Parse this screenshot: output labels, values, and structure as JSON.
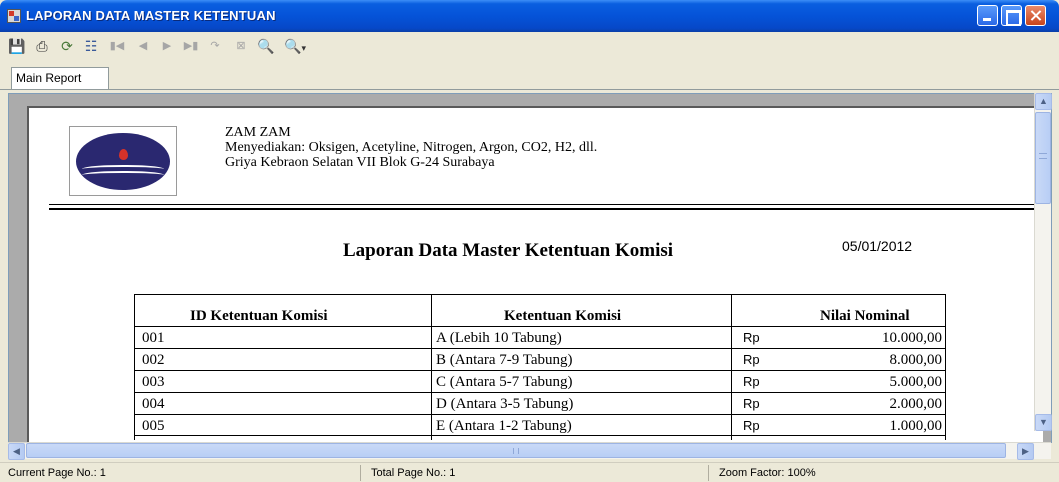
{
  "window": {
    "title": "LAPORAN DATA MASTER KETENTUAN"
  },
  "toolbar": {
    "buttons": [
      {
        "name": "export-icon",
        "glyph": "⎘"
      },
      {
        "name": "print-icon",
        "glyph": "⎙"
      },
      {
        "name": "refresh-icon",
        "glyph": "⟳"
      },
      {
        "name": "group-tree-icon",
        "glyph": "☷"
      },
      {
        "name": "first-page-icon",
        "glyph": "⏮"
      },
      {
        "name": "previous-page-icon",
        "glyph": "◀"
      },
      {
        "name": "next-page-icon",
        "glyph": "▶"
      },
      {
        "name": "last-page-icon",
        "glyph": "⏭"
      },
      {
        "name": "goto-page-icon",
        "glyph": "⤵"
      },
      {
        "name": "close-view-icon",
        "glyph": "⊠"
      },
      {
        "name": "find-icon",
        "glyph": "⚲"
      },
      {
        "name": "zoom-icon",
        "glyph": "⚲"
      }
    ]
  },
  "tabs": {
    "main_report": "Main Report"
  },
  "report": {
    "company_name": "ZAM ZAM",
    "company_desc": "Menyediakan: Oksigen, Acetyline, Nitrogen, Argon, CO2, H2, dll.",
    "company_address": "Griya Kebraon Selatan VII Blok G-24 Surabaya",
    "title": "Laporan Data Master Ketentuan Komisi",
    "date": "05/01/2012",
    "columns": [
      "ID  Ketentuan Komisi",
      "Ketentuan Komisi",
      "Nilai Nominal"
    ],
    "rows": [
      {
        "id": "001",
        "ketentuan": "A (Lebih 10 Tabung)",
        "currency": "Rp",
        "nominal": "10.000,00"
      },
      {
        "id": "002",
        "ketentuan": "B (Antara 7-9 Tabung)",
        "currency": "Rp",
        "nominal": "8.000,00"
      },
      {
        "id": "003",
        "ketentuan": "C (Antara 5-7 Tabung)",
        "currency": "Rp",
        "nominal": "5.000,00"
      },
      {
        "id": "004",
        "ketentuan": "D (Antara 3-5 Tabung)",
        "currency": "Rp",
        "nominal": "2.000,00"
      },
      {
        "id": "005",
        "ketentuan": "E (Antara 1-2 Tabung)",
        "currency": "Rp",
        "nominal": "1.000,00"
      }
    ]
  },
  "status": {
    "current_page": "Current Page No.: 1",
    "total_page": "Total Page No.: 1",
    "zoom": "Zoom Factor: 100%"
  }
}
